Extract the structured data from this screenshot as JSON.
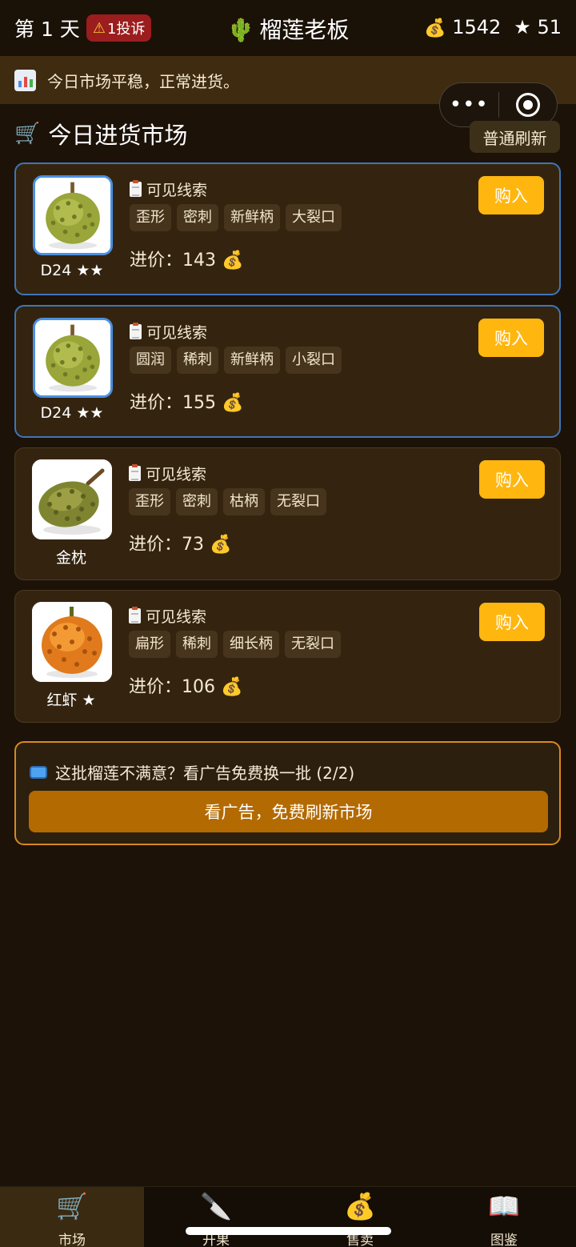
{
  "header": {
    "day": "第 1 天",
    "complaint_icon": "⚠",
    "complaint": "1投诉",
    "title_icon": "🌵",
    "title": "榴莲老板",
    "coin_icon": "💰",
    "coins": "1542",
    "star_icon": "★",
    "stars": "51"
  },
  "notice": {
    "text": "今日市场平稳，正常进货。"
  },
  "capsule": {
    "more": "•••"
  },
  "market": {
    "cart_icon": "🛒",
    "title": "今日进货市场",
    "refresh_label": "普通刷新"
  },
  "cards": [
    {
      "name": "D24 ★★",
      "clue_title": "可见线索",
      "tags": [
        "歪形",
        "密刺",
        "新鲜柄",
        "大裂口"
      ],
      "price": "进价：143 💰",
      "buy": "购入",
      "selected": true
    },
    {
      "name": "D24 ★★",
      "clue_title": "可见线索",
      "tags": [
        "圆润",
        "稀刺",
        "新鲜柄",
        "小裂口"
      ],
      "price": "进价：155 💰",
      "buy": "购入",
      "selected": true
    },
    {
      "name": "金枕",
      "clue_title": "可见线索",
      "tags": [
        "歪形",
        "密刺",
        "枯柄",
        "无裂口"
      ],
      "price": "进价：73 💰",
      "buy": "购入",
      "selected": false
    },
    {
      "name": "红虾 ★",
      "clue_title": "可见线索",
      "tags": [
        "扁形",
        "稀刺",
        "细长柄",
        "无裂口"
      ],
      "price": "进价：106 💰",
      "buy": "购入",
      "selected": false
    }
  ],
  "ad": {
    "text": "这批榴莲不满意？看广告免费换一批 (2/2)",
    "button": "看广告，免费刷新市场"
  },
  "tabs": [
    {
      "icon": "🛒",
      "label": "市场"
    },
    {
      "icon": "🔪",
      "label": "开果"
    },
    {
      "icon": "💰",
      "label": "售卖"
    },
    {
      "icon": "📖",
      "label": "图鉴"
    }
  ],
  "colors": {
    "accent": "#ffb60f",
    "ad_button": "#b36a00",
    "selected_border": "#4a90e2"
  }
}
